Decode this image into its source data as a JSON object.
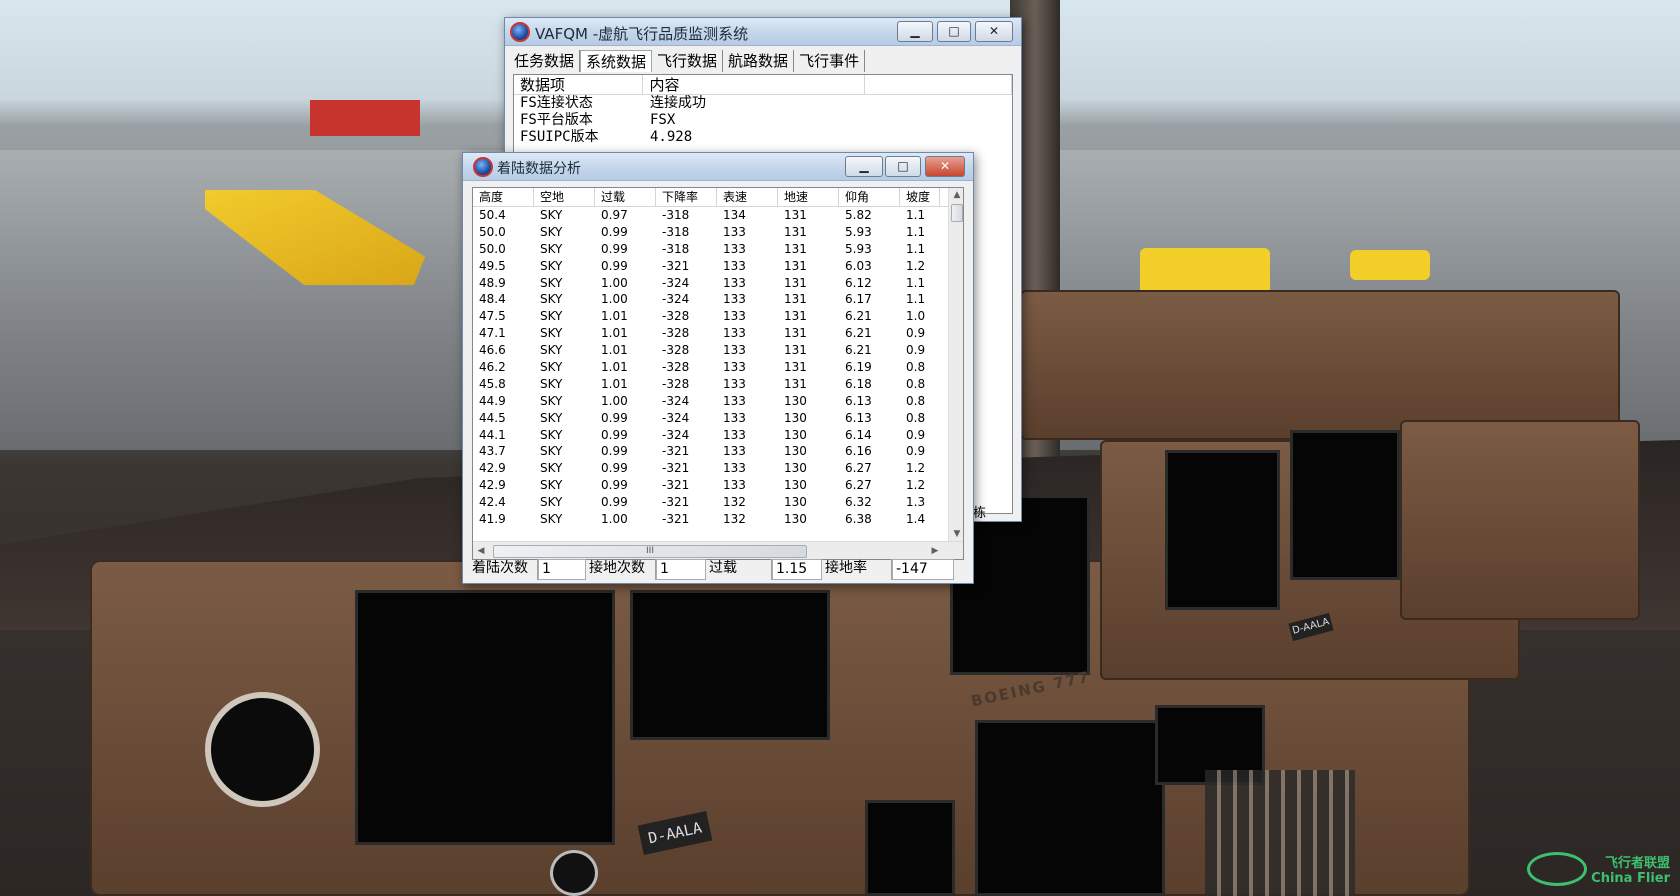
{
  "scene": {
    "registration": "D-AALA",
    "registration_right": "D-AALA",
    "panel_brand": "BOEING 777",
    "side_text": "栋"
  },
  "main_window": {
    "title": "VAFQM -虚航飞行品质监测系统",
    "controls": {
      "minimize": "▁",
      "maximize": "□",
      "close": "✕"
    },
    "tabs": [
      "任务数据",
      "系统数据",
      "飞行数据",
      "航路数据",
      "飞行事件"
    ],
    "active_tab": 1,
    "columns": [
      "数据项",
      "内容"
    ],
    "rows": [
      [
        "FS连接状态",
        "连接成功"
      ],
      [
        "FS平台版本",
        "FSX"
      ],
      [
        "FSUIPC版本",
        "4.928"
      ]
    ]
  },
  "landing_window": {
    "title": "着陆数据分析",
    "controls": {
      "minimize": "▁",
      "maximize": "□",
      "close": "✕"
    },
    "columns": [
      "高度",
      "空地",
      "过载",
      "下降率",
      "表速",
      "地速",
      "仰角",
      "坡度"
    ],
    "rows": [
      [
        "50.4",
        "SKY",
        "0.97",
        "-318",
        "134",
        "131",
        "5.82",
        "1.1"
      ],
      [
        "50.0",
        "SKY",
        "0.99",
        "-318",
        "133",
        "131",
        "5.93",
        "1.1"
      ],
      [
        "50.0",
        "SKY",
        "0.99",
        "-318",
        "133",
        "131",
        "5.93",
        "1.1"
      ],
      [
        "49.5",
        "SKY",
        "0.99",
        "-321",
        "133",
        "131",
        "6.03",
        "1.2"
      ],
      [
        "48.9",
        "SKY",
        "1.00",
        "-324",
        "133",
        "131",
        "6.12",
        "1.1"
      ],
      [
        "48.4",
        "SKY",
        "1.00",
        "-324",
        "133",
        "131",
        "6.17",
        "1.1"
      ],
      [
        "47.5",
        "SKY",
        "1.01",
        "-328",
        "133",
        "131",
        "6.21",
        "1.0"
      ],
      [
        "47.1",
        "SKY",
        "1.01",
        "-328",
        "133",
        "131",
        "6.21",
        "0.9"
      ],
      [
        "46.6",
        "SKY",
        "1.01",
        "-328",
        "133",
        "131",
        "6.21",
        "0.9"
      ],
      [
        "46.2",
        "SKY",
        "1.01",
        "-328",
        "133",
        "131",
        "6.19",
        "0.8"
      ],
      [
        "45.8",
        "SKY",
        "1.01",
        "-328",
        "133",
        "131",
        "6.18",
        "0.8"
      ],
      [
        "44.9",
        "SKY",
        "1.00",
        "-324",
        "133",
        "130",
        "6.13",
        "0.8"
      ],
      [
        "44.5",
        "SKY",
        "0.99",
        "-324",
        "133",
        "130",
        "6.13",
        "0.8"
      ],
      [
        "44.1",
        "SKY",
        "0.99",
        "-324",
        "133",
        "130",
        "6.14",
        "0.9"
      ],
      [
        "43.7",
        "SKY",
        "0.99",
        "-321",
        "133",
        "130",
        "6.16",
        "0.9"
      ],
      [
        "42.9",
        "SKY",
        "0.99",
        "-321",
        "133",
        "130",
        "6.27",
        "1.2"
      ],
      [
        "42.9",
        "SKY",
        "0.99",
        "-321",
        "133",
        "130",
        "6.27",
        "1.2"
      ],
      [
        "42.4",
        "SKY",
        "0.99",
        "-321",
        "132",
        "130",
        "6.32",
        "1.3"
      ],
      [
        "41.9",
        "SKY",
        "1.00",
        "-321",
        "132",
        "130",
        "6.38",
        "1.4"
      ]
    ],
    "hscroll_grip": "III",
    "status": {
      "landings_label": "着陆次数",
      "landings": "1",
      "touchdowns_label": "接地次数",
      "touchdowns": "1",
      "g_label": "过载",
      "g": "1.15",
      "rate_label": "接地率",
      "rate": "-147"
    }
  },
  "watermark": {
    "line1": "飞行者联盟",
    "line2": "China Flier"
  }
}
